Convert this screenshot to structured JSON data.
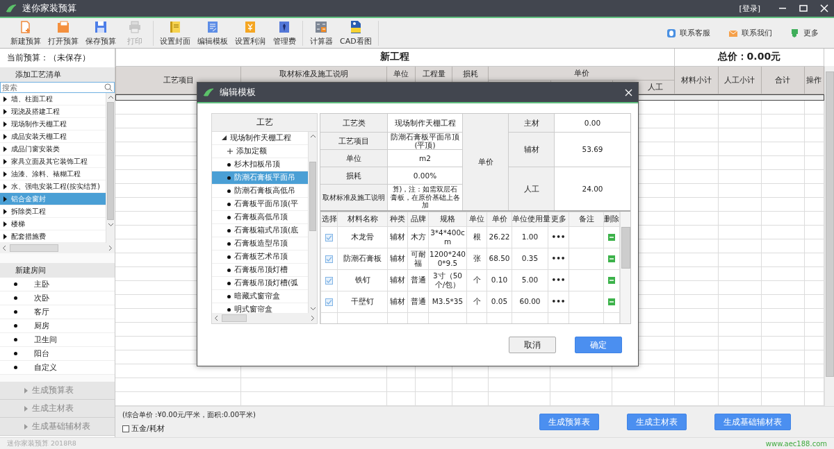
{
  "window": {
    "title": "迷你家装预算",
    "login": "[登录]"
  },
  "toolbar": {
    "groups": [
      [
        {
          "kind": "new",
          "label": "新建预算",
          "disabled": false
        },
        {
          "kind": "open",
          "label": "打开预算",
          "disabled": false
        },
        {
          "kind": "save",
          "label": "保存预算",
          "disabled": false
        },
        {
          "kind": "print",
          "label": "打印",
          "disabled": true
        }
      ],
      [
        {
          "kind": "cover",
          "label": "设置封面",
          "disabled": false
        },
        {
          "kind": "template",
          "label": "编辑模板",
          "disabled": false
        },
        {
          "kind": "profit",
          "label": "设置利润",
          "disabled": false
        },
        {
          "kind": "fee",
          "label": "管理费",
          "disabled": false
        }
      ],
      [
        {
          "kind": "calculator",
          "label": "计算器",
          "disabled": false
        },
        {
          "kind": "cad",
          "label": "CAD看图",
          "disabled": false
        }
      ]
    ],
    "links": [
      {
        "kind": "service",
        "label": "联系客服"
      },
      {
        "kind": "mail",
        "label": "联系我们"
      },
      {
        "kind": "more",
        "label": "更多"
      }
    ]
  },
  "sidebar": {
    "budget_label": "当前预算：",
    "budget_value": "（未保存）",
    "craft_header": "添加工艺清单",
    "search": {
      "placeholder": "搜索"
    },
    "craft_items": [
      {
        "label": "墙、柱面工程",
        "selected": false
      },
      {
        "label": "现浇及搭建工程",
        "selected": false
      },
      {
        "label": "现场制作天棚工程",
        "selected": false
      },
      {
        "label": "成品安装天棚工程",
        "selected": false
      },
      {
        "label": "成品门窗安装类",
        "selected": false
      },
      {
        "label": "家具立面及其它装饰工程",
        "selected": false
      },
      {
        "label": "油漆、涂料、裱糊工程",
        "selected": false
      },
      {
        "label": "水、强电安装工程(按实结算)",
        "selected": false
      },
      {
        "label": "铝合金窗封",
        "selected": true
      },
      {
        "label": "拆除类工程",
        "selected": false
      },
      {
        "label": "楼梯",
        "selected": false
      },
      {
        "label": "配套措施费",
        "selected": false
      }
    ],
    "rooms_header": "新建房间",
    "rooms": [
      "主卧",
      "次卧",
      "客厅",
      "厨房",
      "卫生间",
      "阳台",
      "自定义"
    ],
    "generate": [
      "生成预算表",
      "生成主材表",
      "生成基础辅材表"
    ]
  },
  "main": {
    "project_title": "新工程",
    "total": "总价：0.00元",
    "columns": [
      {
        "kind": "single",
        "label": "工艺项目"
      },
      {
        "kind": "single",
        "label": "取材标准及施工说明"
      },
      {
        "kind": "single",
        "label": "单位"
      },
      {
        "kind": "single",
        "label": "工程量"
      },
      {
        "kind": "single",
        "label": "损耗"
      },
      {
        "kind": "group",
        "label": "单价",
        "sublabel": "人工"
      },
      {
        "kind": "single",
        "label": "材料小计"
      },
      {
        "kind": "single",
        "label": "人工小计"
      },
      {
        "kind": "single",
        "label": "合计"
      },
      {
        "kind": "single",
        "label": "操作"
      }
    ]
  },
  "footer": {
    "summary": "(综合单价 :¥0.00元/平米，面积:0.00平米)",
    "checkbox": {
      "label": "五金/耗材",
      "checked": false
    },
    "buttons": [
      "生成预算表",
      "生成主材表",
      "生成基础辅材表"
    ]
  },
  "status_bar": {
    "version": "迷你家装预算 2018R8",
    "website": "www.aec188.com"
  },
  "dialog": {
    "title": "编辑模板",
    "tree": {
      "header": "工艺",
      "root": {
        "label": "现场制作天棚工程",
        "expanded": true,
        "children": [
          {
            "kind": "add",
            "label": "添加定额",
            "selected": false
          },
          {
            "kind": "item",
            "label": "杉木扣板吊顶",
            "selected": false
          },
          {
            "kind": "item",
            "label": "防潮石膏板平面吊",
            "selected": true
          },
          {
            "kind": "item",
            "label": "防潮石膏板高低吊",
            "selected": false
          },
          {
            "kind": "item",
            "label": "石膏板平面吊顶(平",
            "selected": false
          },
          {
            "kind": "item",
            "label": "石膏板高低吊顶",
            "selected": false
          },
          {
            "kind": "item",
            "label": "石膏板箱式吊顶(底",
            "selected": false
          },
          {
            "kind": "item",
            "label": "石膏板造型吊顶",
            "selected": false
          },
          {
            "kind": "item",
            "label": "石膏板艺术吊顶",
            "selected": false
          },
          {
            "kind": "item",
            "label": "石膏板吊顶灯槽",
            "selected": false
          },
          {
            "kind": "item",
            "label": "石膏板吊顶灯槽(弧",
            "selected": false
          },
          {
            "kind": "item",
            "label": "暗藏式窗帘盒",
            "selected": false
          },
          {
            "kind": "item",
            "label": "明式窗帘盒",
            "selected": false
          }
        ]
      }
    },
    "info": {
      "rows": [
        {
          "label": "工艺类",
          "value": "现场制作天棚工程"
        },
        {
          "label": "工艺项目",
          "value": "防潮石膏板平面吊顶(平顶)"
        },
        {
          "label": "单位",
          "value": "m2"
        },
        {
          "label": "损耗",
          "value": "0.00%"
        },
        {
          "label": "取材标准及施工说明",
          "value": "算)，注：如需双层石膏板，在原价基础上各加"
        }
      ],
      "price_label": "单价",
      "price_rows": [
        {
          "label": "主材",
          "value": "0.00"
        },
        {
          "label": "辅材",
          "value": "53.69"
        },
        {
          "label": "人工",
          "value": "24.00"
        }
      ]
    },
    "materials": {
      "columns": [
        "选择",
        "材料名称",
        "种类",
        "品牌",
        "规格",
        "单位",
        "单价",
        "单位使用量",
        "更多",
        "备注",
        "删除"
      ],
      "rows": [
        {
          "checked": true,
          "name": "木龙骨",
          "type": "辅材",
          "brand": "木方",
          "spec": "3*4*400cm",
          "unit": "根",
          "price": "26.22",
          "usage": "1.00",
          "more": "•••"
        },
        {
          "checked": true,
          "name": "防潮石膏板",
          "type": "辅材",
          "brand": "可耐福",
          "spec": "1200*2400*9.5",
          "unit": "张",
          "price": "68.50",
          "usage": "0.35",
          "more": "•••"
        },
        {
          "checked": true,
          "name": "铁钉",
          "type": "辅材",
          "brand": "普通",
          "spec": "3寸（50个/包）",
          "unit": "个",
          "price": "0.10",
          "usage": "5.00",
          "more": "•••"
        },
        {
          "checked": true,
          "name": "干壁钉",
          "type": "辅材",
          "brand": "普通",
          "spec": "M3.5*35",
          "unit": "个",
          "price": "0.05",
          "usage": "60.00",
          "more": "•••"
        }
      ]
    },
    "buttons": [
      {
        "kind": "cancel",
        "label": "取消"
      },
      {
        "kind": "ok",
        "label": "确定"
      }
    ]
  }
}
